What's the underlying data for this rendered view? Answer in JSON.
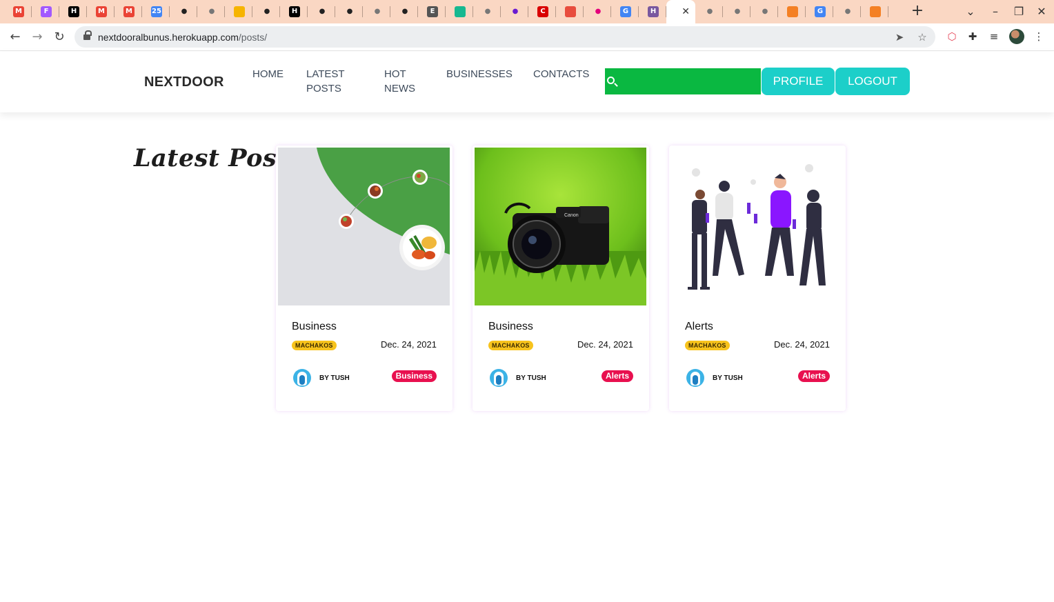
{
  "browser": {
    "url_host": "nextdooralbunus.herokuapp.com",
    "url_path": "/posts/",
    "tab_close": "✕",
    "new_tab": "+",
    "tabs": [
      {
        "icon": "gmail-icon",
        "glyph": "M",
        "color": "#ea4335"
      },
      {
        "icon": "figma-icon",
        "glyph": "F",
        "color": "#a259ff"
      },
      {
        "icon": "hackernoon-icon",
        "glyph": "H",
        "color": "#000000"
      },
      {
        "icon": "gmail-icon",
        "glyph": "M",
        "color": "#ea4335"
      },
      {
        "icon": "gmail-icon",
        "glyph": "M",
        "color": "#ea4335"
      },
      {
        "icon": "calendar-icon",
        "glyph": "25",
        "color": "#4285f4"
      },
      {
        "icon": "github-icon",
        "glyph": "●",
        "color": "#222222"
      },
      {
        "icon": "globe-icon",
        "glyph": "●",
        "color": "#777777"
      },
      {
        "icon": "firebase-icon",
        "glyph": "▲",
        "color": "#f6b400"
      },
      {
        "icon": "github-icon",
        "glyph": "●",
        "color": "#222222"
      },
      {
        "icon": "hackernoon-icon",
        "glyph": "H",
        "color": "#000000"
      },
      {
        "icon": "github-icon",
        "glyph": "●",
        "color": "#222222"
      },
      {
        "icon": "github-icon",
        "glyph": "●",
        "color": "#222222"
      },
      {
        "icon": "globe-icon",
        "glyph": "●",
        "color": "#777777"
      },
      {
        "icon": "github-icon",
        "glyph": "●",
        "color": "#222222"
      },
      {
        "icon": "audio-tab-icon",
        "glyph": "E",
        "color": "#555555"
      },
      {
        "icon": "heart-icon",
        "glyph": "♥",
        "color": "#17b890"
      },
      {
        "icon": "globe-icon",
        "glyph": "●",
        "color": "#777777"
      },
      {
        "icon": "record-icon",
        "glyph": "●",
        "color": "#6a1bd1"
      },
      {
        "icon": "c-icon",
        "glyph": "C",
        "color": "#d90000"
      },
      {
        "icon": "pinwheel-icon",
        "glyph": "✱",
        "color": "#e84c3d"
      },
      {
        "icon": "pink-dot-icon",
        "glyph": "●",
        "color": "#e4007c"
      },
      {
        "icon": "google-icon",
        "glyph": "G",
        "color": "#4285f4"
      },
      {
        "icon": "heroku-icon",
        "glyph": "H",
        "color": "#79589f"
      },
      {
        "icon": "active-tab-icon",
        "glyph": "",
        "color": "#ffffff"
      },
      {
        "icon": "globe-icon",
        "glyph": "●",
        "color": "#777777"
      },
      {
        "icon": "globe-icon",
        "glyph": "●",
        "color": "#777777"
      },
      {
        "icon": "globe-icon",
        "glyph": "●",
        "color": "#777777"
      },
      {
        "icon": "stackoverflow-icon",
        "glyph": "≡",
        "color": "#f48024"
      },
      {
        "icon": "google-icon",
        "glyph": "G",
        "color": "#4285f4"
      },
      {
        "icon": "globe-icon",
        "glyph": "●",
        "color": "#777777"
      },
      {
        "icon": "stackoverflow-icon",
        "glyph": "≡",
        "color": "#f48024"
      }
    ]
  },
  "site": {
    "brand": "NEXTDOOR",
    "nav": [
      {
        "label": "HOME"
      },
      {
        "label": "LATEST POSTS"
      },
      {
        "label": "HOT NEWS"
      },
      {
        "label": "BUSINESSES"
      },
      {
        "label": "CONTACTS"
      }
    ],
    "search": {
      "value": "",
      "placeholder": ""
    },
    "profile_label": "PROFILE",
    "logout_label": "LOGOUT",
    "colors": {
      "search": "#0ab841",
      "buttons": "#1ccfc9",
      "tag": "#e8104f",
      "location": "#f7c31d"
    }
  },
  "main": {
    "title": "Latest Posts",
    "posts": [
      {
        "category": "Business",
        "location": "MACHAKOS",
        "date": "Dec. 24, 2021",
        "author": "BY TUSH",
        "tag": "Business",
        "image": "food-delivery-illustration"
      },
      {
        "category": "Business",
        "location": "MACHAKOS",
        "date": "Dec. 24, 2021",
        "author": "BY TUSH",
        "tag": "Alerts",
        "image": "camera-on-grass-photo"
      },
      {
        "category": "Alerts",
        "location": "MACHAKOS",
        "date": "Dec. 24, 2021",
        "author": "BY TUSH",
        "tag": "Alerts",
        "image": "people-toasting-illustration"
      }
    ]
  }
}
